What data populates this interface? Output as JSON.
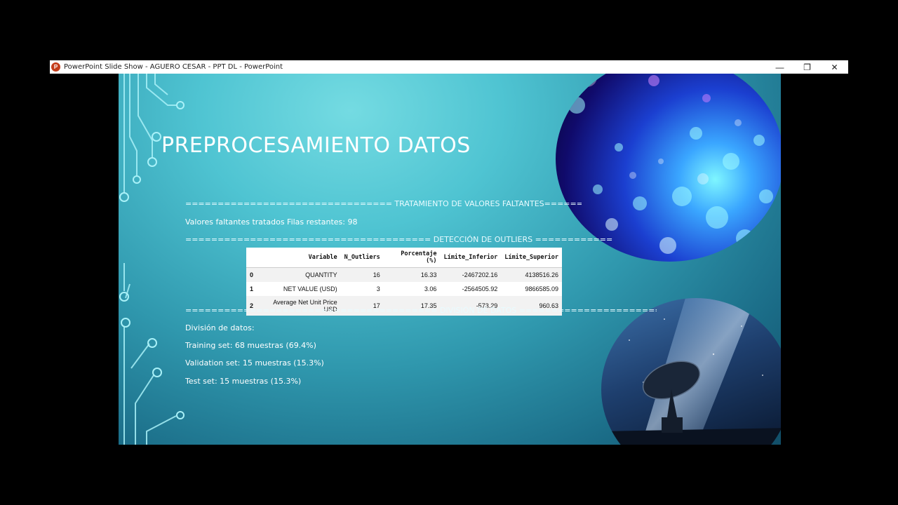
{
  "window": {
    "title": "PowerPoint Slide Show  -  AGUERO CESAR - PPT DL - PowerPoint",
    "app_icon_label": "P",
    "minimize": "—",
    "restore": "❐",
    "close": "✕"
  },
  "slide": {
    "title": "PREPROCESAMIENTO DATOS",
    "sep_missing": "================================ TRATAMIENTO DE VALORES FALTANTES================================",
    "missing_result": "Valores faltantes tratados Filas restantes: 98",
    "sep_outliers": "====================================== DETECCIÓN DE OUTLIERS ======================================",
    "table": {
      "headers": [
        "",
        "Variable",
        "N_Outliers",
        "Porcentaje (%)",
        "Límite_Inferior",
        "Límite_Superior"
      ],
      "rows": [
        [
          "0",
          "QUANTITY",
          "16",
          "16.33",
          "-2467202.16",
          "4138516.26"
        ],
        [
          "1",
          "NET VALUE (USD)",
          "3",
          "3.06",
          "-2564505.92",
          "9866585.09"
        ],
        [
          "2",
          "Average Net Unit Price USD",
          "17",
          "17.35",
          "-573.29",
          "960.63"
        ]
      ]
    },
    "sep_division": "======================================= DIVISIÓN DE DATOS =======================================",
    "division_title": " División de datos:",
    "training": "Training set: 68 muestras (69.4%)",
    "validation": "Validation set: 15 muestras (15.3%)",
    "test": "Test set: 15 muestras (15.3%)"
  }
}
